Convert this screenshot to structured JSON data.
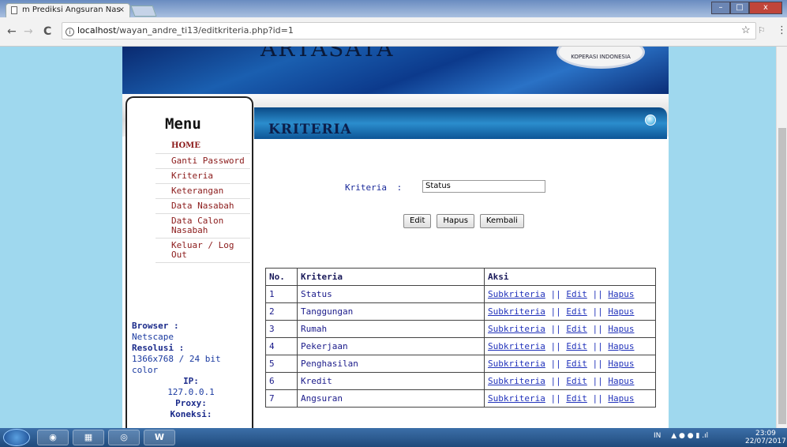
{
  "browser": {
    "tab_title": "m Prediksi Angsuran Nas",
    "tab_close": "×",
    "url_host": "localhost",
    "url_path": "/wayan_andre_ti13/editkriteria.php?id=1",
    "info_icon": "i",
    "back": "←",
    "forward": "→",
    "reload": "C",
    "star": "☆",
    "menu": "⋮",
    "win_min": "–",
    "win_max": "□",
    "win_close": "x"
  },
  "banner": {
    "text": "ARTASATA",
    "logo_text": "KOPERASI INDONESIA"
  },
  "sidebar": {
    "title": "Menu",
    "items": [
      {
        "label": "HOME"
      },
      {
        "label": "Ganti Password"
      },
      {
        "label": "Kriteria"
      },
      {
        "label": "Keterangan"
      },
      {
        "label": "Data Nasabah"
      },
      {
        "label": "Data Calon Nasabah"
      },
      {
        "label": "Keluar / Log Out"
      }
    ],
    "browser_label": "Browser :",
    "browser_value": "Netscape",
    "resolusi_label": "Resolusi :",
    "resolusi_value": "1366x768 / 24 bit color",
    "ip_label": "IP:",
    "ip_value": "127.0.0.1",
    "proxy_label": "Proxy:",
    "koneksi_label": "Koneksi:"
  },
  "main": {
    "header": "KRITERIA",
    "form_label": "Kriteria",
    "form_colon": ":",
    "form_value": "Status",
    "buttons": {
      "edit": "Edit",
      "hapus": "Hapus",
      "kembali": "Kembali"
    }
  },
  "table": {
    "headers": [
      "No.",
      "Kriteria",
      "Aksi"
    ],
    "action_labels": {
      "sub": "Subkriteria",
      "edit": "Edit",
      "hapus": "Hapus",
      "sep": "||"
    },
    "rows": [
      {
        "no": "1",
        "kriteria": "Status"
      },
      {
        "no": "2",
        "kriteria": "Tanggungan"
      },
      {
        "no": "3",
        "kriteria": "Rumah"
      },
      {
        "no": "4",
        "kriteria": "Pekerjaan"
      },
      {
        "no": "5",
        "kriteria": "Penghasilan"
      },
      {
        "no": "6",
        "kriteria": "Kredit"
      },
      {
        "no": "7",
        "kriteria": "Angsuran"
      }
    ]
  },
  "taskbar": {
    "lang": "IN",
    "time": "23:09",
    "date": "22/07/2017",
    "word_label": "W"
  }
}
